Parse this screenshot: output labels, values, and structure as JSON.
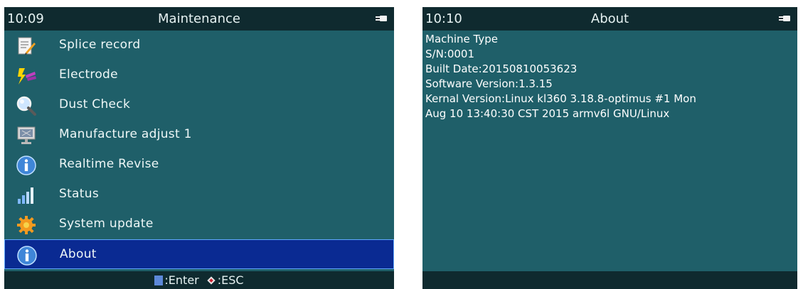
{
  "left_screen": {
    "time": "10:09",
    "title": "Maintenance",
    "menu": [
      {
        "label": "Splice record",
        "icon": "notepad-pencil-icon",
        "selected": false
      },
      {
        "label": "Electrode",
        "icon": "electrode-spark-icon",
        "selected": false
      },
      {
        "label": "Dust Check",
        "icon": "magnifier-icon",
        "selected": false
      },
      {
        "label": "Manufacture adjust 1",
        "icon": "monitor-icon",
        "selected": false
      },
      {
        "label": "Realtime Revise",
        "icon": "info-icon",
        "selected": false
      },
      {
        "label": "Status",
        "icon": "signal-bars-icon",
        "selected": false
      },
      {
        "label": "System update",
        "icon": "gear-update-icon",
        "selected": false
      },
      {
        "label": "About",
        "icon": "info-icon",
        "selected": true
      }
    ],
    "footer": {
      "enter_label": ":Enter",
      "esc_label": ":ESC"
    }
  },
  "right_screen": {
    "time": "10:10",
    "title": "About",
    "lines": [
      "Machine Type",
      "S/N:0001",
      "Built Date:20150810053623",
      "Software Version:1.3.15",
      "Kernal Version:Linux kl360 3.18.8-optimus #1 Mon",
      "Aug 10 13:40:30 CST 2015 armv6l GNU/Linux"
    ]
  },
  "colors": {
    "screen_bg": "#1f5f69",
    "bar_bg": "#0f2a2f",
    "selected_bg": "#0a2a92"
  }
}
